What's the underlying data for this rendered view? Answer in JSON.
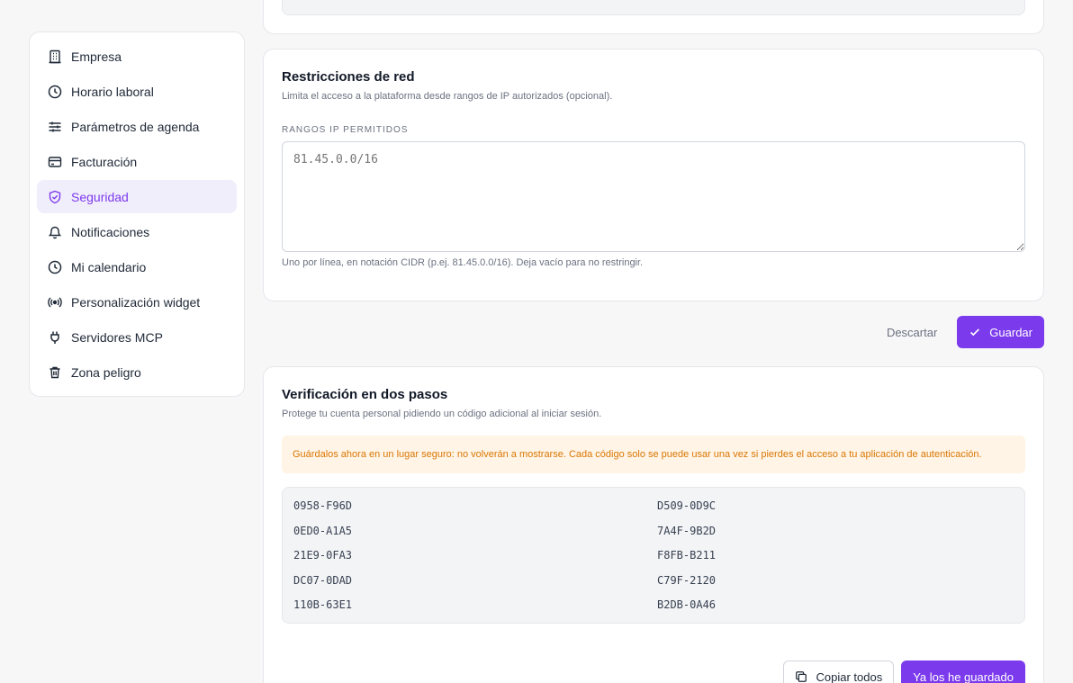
{
  "sidebar": {
    "items": [
      {
        "label": "Empresa",
        "icon": "building-icon"
      },
      {
        "label": "Horario laboral",
        "icon": "clock-icon"
      },
      {
        "label": "Parámetros de agenda",
        "icon": "sliders-icon"
      },
      {
        "label": "Facturación",
        "icon": "credit-card-icon"
      },
      {
        "label": "Seguridad",
        "icon": "shield-check-icon",
        "active": true
      },
      {
        "label": "Notificaciones",
        "icon": "bell-icon"
      },
      {
        "label": "Mi calendario",
        "icon": "calendar-icon"
      },
      {
        "label": "Personalización widget",
        "icon": "broadcast-icon"
      },
      {
        "label": "Servidores MCP",
        "icon": "plug-icon"
      },
      {
        "label": "Zona peligro",
        "icon": "trash-icon"
      }
    ]
  },
  "network": {
    "title": "Restricciones de red",
    "description": "Limita el acceso a la plataforma desde rangos de IP autorizados (opcional).",
    "field_label": "Rangos IP permitidos",
    "placeholder": "81.45.0.0/16",
    "value": "",
    "hint": "Uno por línea, en notación CIDR (p.ej. 81.45.0.0/16). Deja vacío para no restringir."
  },
  "form_actions": {
    "discard_label": "Descartar",
    "save_label": "Guardar"
  },
  "two_factor": {
    "title": "Verificación en dos pasos",
    "description": "Protege tu cuenta personal pidiendo un código adicional al iniciar sesión.",
    "warning": "Guárdalos ahora en un lugar seguro: no volverán a mostrarse. Cada código solo se puede usar una vez si pierdes el acceso a tu aplicación de autenticación.",
    "codes": [
      "0958-F96D",
      "D509-0D9C",
      "0ED0-A1A5",
      "7A4F-9B2D",
      "21E9-0FA3",
      "F8FB-B211",
      "DC07-0DAD",
      "C79F-2120",
      "110B-63E1",
      "B2DB-0A46"
    ],
    "copy_label": "Copiar todos",
    "done_label": "Ya los he guardado"
  },
  "colors": {
    "accent": "#7c3aed",
    "warning_bg": "#fff4e5",
    "warning_text": "#d97706"
  }
}
